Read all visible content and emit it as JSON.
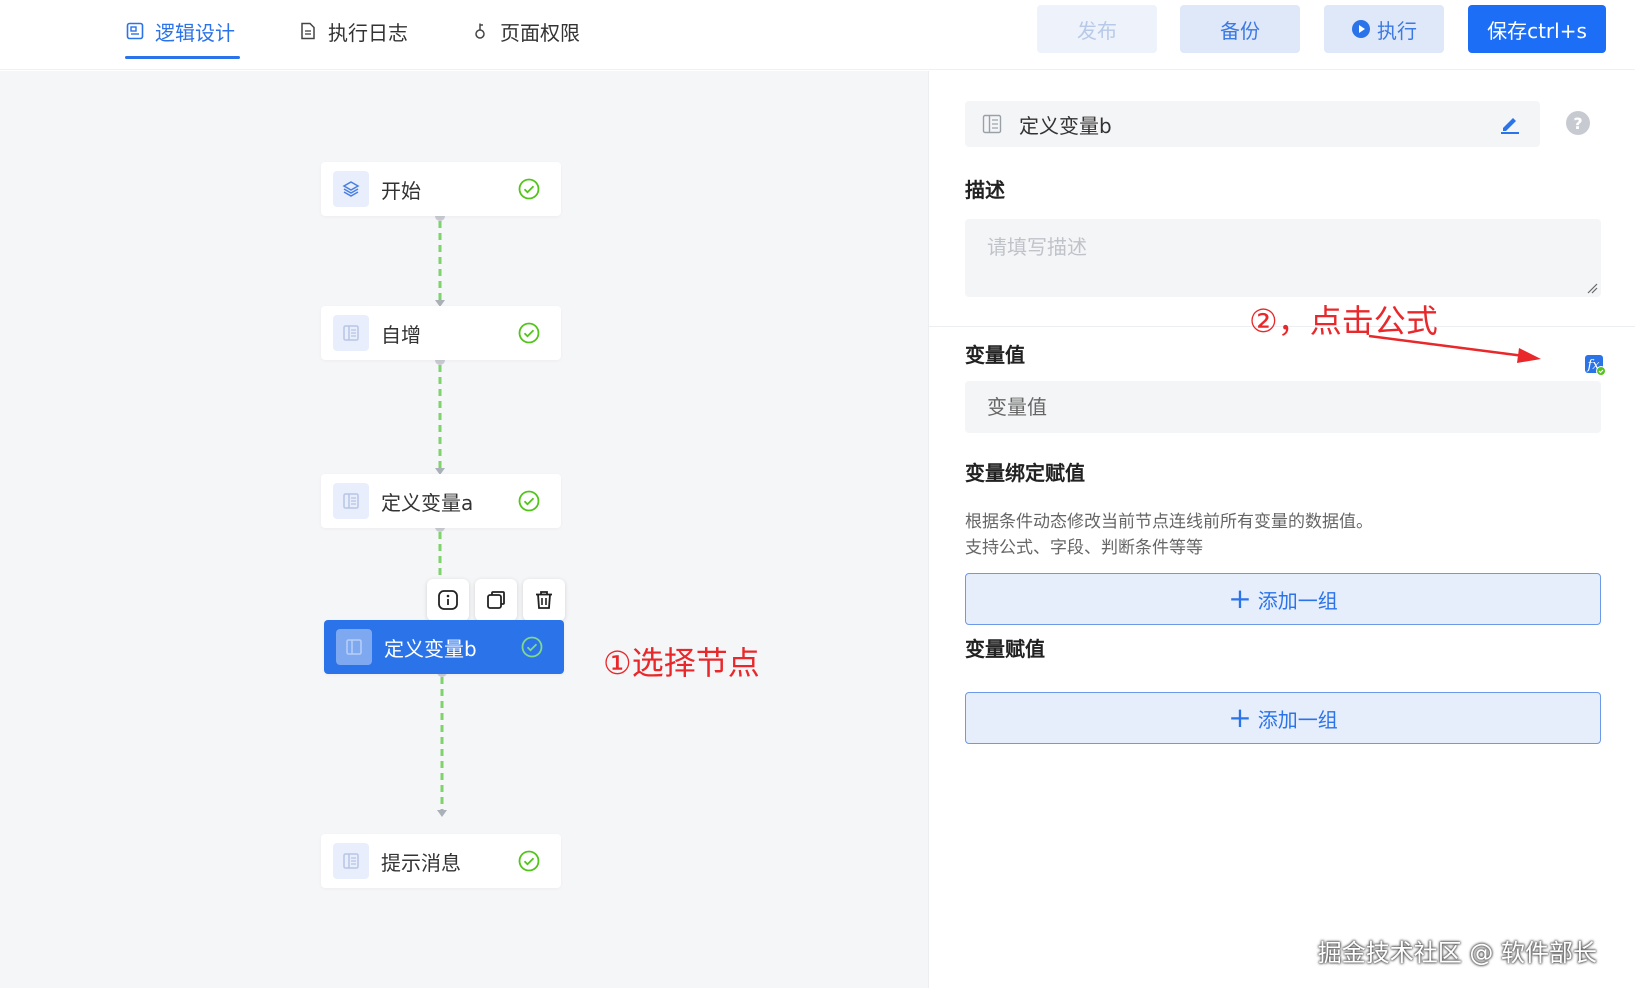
{
  "header": {
    "tabs": [
      {
        "label": "逻辑设计",
        "icon": "logic-design-icon",
        "active": true
      },
      {
        "label": "执行日志",
        "icon": "document-icon",
        "active": false
      },
      {
        "label": "页面权限",
        "icon": "key-icon",
        "active": false
      }
    ],
    "buttons": {
      "publish": "发布",
      "backup": "备份",
      "run": "执行",
      "save": "保存ctrl+s"
    }
  },
  "flow": {
    "nodes": [
      {
        "label": "开始",
        "icon": "layers-icon",
        "status": "ok"
      },
      {
        "label": "自增",
        "icon": "table-icon",
        "status": "ok"
      },
      {
        "label": "定义变量a",
        "icon": "table-icon",
        "status": "ok"
      },
      {
        "label": "定义变量b",
        "icon": "table-icon",
        "status": "ok",
        "selected": true
      },
      {
        "label": "提示消息",
        "icon": "table-icon",
        "status": "ok"
      }
    ],
    "toolbar": [
      "info-icon",
      "copy-icon",
      "delete-icon"
    ],
    "annotation": "①选择节点"
  },
  "panel": {
    "node_name": "定义变量b",
    "desc_title": "描述",
    "desc_placeholder": "请填写描述",
    "annotation": "②，点击公式",
    "value_title": "变量值",
    "value_placeholder": "变量值",
    "bind_title": "变量绑定赋值",
    "bind_hint_1": "根据条件动态修改当前节点连线前所有变量的数据值。",
    "bind_hint_2": "支持公式、字段、判断条件等等",
    "bind_add": "添加一组",
    "assign_title": "变量赋值",
    "assign_add": "添加一组"
  },
  "watermark": "掘金技术社区 @ 软件部长",
  "colors": {
    "primary": "#2b73e8",
    "success": "#52c41a",
    "annotation": "#e8282b",
    "connector": "#7ed36b"
  }
}
